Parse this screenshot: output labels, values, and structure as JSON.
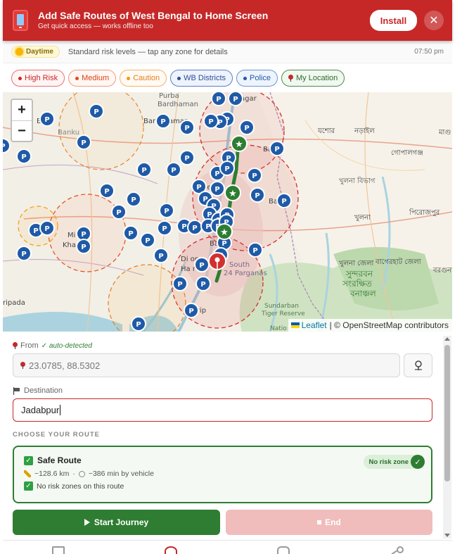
{
  "banner": {
    "title": "Add Safe Routes of West Bengal to Home Screen",
    "subtitle": "Get quick access — works offline too",
    "install_label": "Install",
    "close_glyph": "✕",
    "icon": "phone-app-icon"
  },
  "status": {
    "mode_label": "Daytime",
    "message": "Standard risk levels — tap any zone for details",
    "time": "07:50 pm",
    "icon": "sun-icon"
  },
  "legend": [
    {
      "key": "high",
      "label": "High Risk"
    },
    {
      "key": "medium",
      "label": "Medium"
    },
    {
      "key": "caution",
      "label": "Caution"
    },
    {
      "key": "districts",
      "label": "WB Districts"
    },
    {
      "key": "police",
      "label": "Police"
    },
    {
      "key": "mylocation",
      "label": "My Location"
    }
  ],
  "map": {
    "zoom_in": "+",
    "zoom_out": "−",
    "attribution_link": "Leaflet",
    "attribution_text": "| © OpenStreetMap contributors",
    "police_marker_glyph": "P",
    "safe_marker_glyph": "★",
    "place_labels": {
      "purba": "Purba",
      "bardhaman": "Bardhaman",
      "bankura": "Bankura",
      "barddhaman": "Barddhaman",
      "bankura_short": "Banku",
      "ba": "Ba",
      "midnapur": "Mi     pur",
      "kharagpur": "Kha     ur",
      "ripada": "ripada",
      "diamond_harbour": "Di     on",
      "harbour": "Ha      r",
      "kakdwip": "K     wip",
      "south_24_parganas": "South",
      "parganas": "24 Parganas",
      "barui": "Baru",
      "sundarban": "Sundarban",
      "tiger_reserve": "Tiger Reserve",
      "national": "Natio",
      "jessore": "যশোর",
      "narail": "নড়াইল",
      "magura": "মাগু",
      "gopalganj": "গোপালগঞ্জ",
      "khulna_division": "খুলনা বিভাগ",
      "khulna": "খুলনা",
      "pirojpur": "পিরোজপুর",
      "khulna_zila": "খুলনা জেলা",
      "bagerhat_zila": "বাগেরহাট জেলা",
      "sundarban_bn": "সুন্দরবন",
      "sundarban_bn2": "সংরক্ষিত",
      "bonanchal": "বনাঞ্চল",
      "barguna": "বরগুনা",
      "ba_north": "Ba",
      "bangaon_label": "Ba",
      "nagar": "agar",
      "se": "Se"
    }
  },
  "form": {
    "from_label": "From",
    "auto_detected": "✓ auto-detected",
    "from_value": "23.0785, 88.5302",
    "destination_label": "Destination",
    "destination_value": "Jadabpur",
    "section_title": "CHOOSE YOUR ROUTE"
  },
  "route": {
    "name": "Safe Route",
    "check_glyph": "✓",
    "badge": "No risk zone",
    "distance": "~128.6 km",
    "separator": "·",
    "duration": "~386 min by vehicle",
    "note": "No risk zones on this route"
  },
  "actions": {
    "start_label": "Start Journey",
    "end_label": "End"
  },
  "colors": {
    "brand_red": "#c62828",
    "safe_green": "#2e7d32",
    "police_blue": "#1f5aa6"
  }
}
